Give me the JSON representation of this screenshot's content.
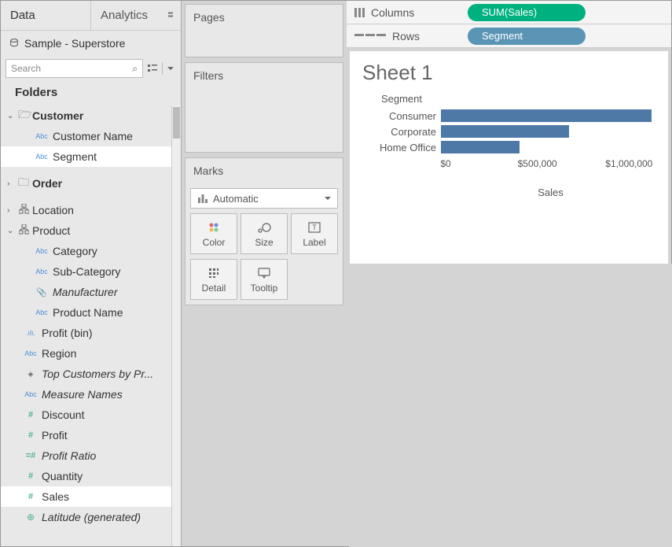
{
  "tabs": {
    "data": "Data",
    "analytics": "Analytics"
  },
  "datasource": "Sample - Superstore",
  "search": {
    "placeholder": "Search"
  },
  "folders_label": "Folders",
  "tree": {
    "customer": {
      "label": "Customer",
      "children": {
        "name": "Customer Name",
        "segment": "Segment"
      }
    },
    "order": {
      "label": "Order"
    },
    "location": "Location",
    "product": {
      "label": "Product",
      "children": {
        "category": "Category",
        "subcat": "Sub-Category",
        "mfr": "Manufacturer",
        "pname": "Product Name"
      }
    },
    "profit_bin": "Profit (bin)",
    "region": "Region",
    "top_cust": "Top Customers by Pr...",
    "measure_names": "Measure Names",
    "discount": "Discount",
    "profit": "Profit",
    "profit_ratio": "Profit Ratio",
    "quantity": "Quantity",
    "sales": "Sales",
    "lat": "Latitude (generated)"
  },
  "shelves": {
    "pages": "Pages",
    "filters": "Filters",
    "marks": "Marks",
    "marks_type": "Automatic",
    "color": "Color",
    "size": "Size",
    "label": "Label",
    "detail": "Detail",
    "tooltip": "Tooltip"
  },
  "columns": {
    "label": "Columns",
    "pill": "SUM(Sales)"
  },
  "rows": {
    "label": "Rows",
    "pill": "Segment"
  },
  "sheet_title": "Sheet 1",
  "chart_data": {
    "type": "bar",
    "title": "Sheet 1",
    "row_header": "Segment",
    "categories": [
      "Consumer",
      "Corporate",
      "Home Office"
    ],
    "values": [
      1150000,
      700000,
      430000
    ],
    "xlabel": "Sales",
    "xlim": [
      0,
      1200000
    ],
    "ticks": [
      {
        "v": 0,
        "l": "$0"
      },
      {
        "v": 500000,
        "l": "$500,000"
      },
      {
        "v": 1000000,
        "l": "$1,000,000"
      }
    ]
  }
}
